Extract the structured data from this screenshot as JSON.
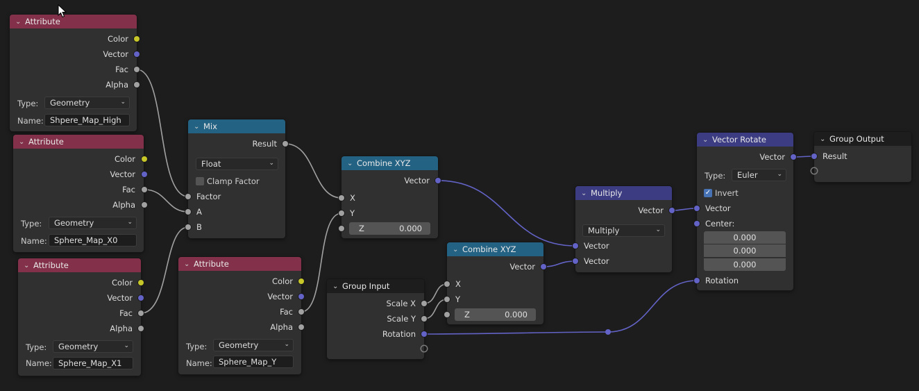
{
  "editor": "Geometry Node Editor",
  "colors": {
    "attribute_header": "#83314a",
    "converter_header": "#246283",
    "vector_header": "#3c3c83",
    "group_header": "#1d1d1d",
    "socket_color": "#c7c729",
    "socket_vector": "#6363c7",
    "socket_float": "#a1a1a1",
    "link_float": "#a1a1a1",
    "link_vector": "#6363c7"
  },
  "nodes": {
    "attr1": {
      "title": "Attribute",
      "outputs": [
        "Color",
        "Vector",
        "Fac",
        "Alpha"
      ],
      "type_label": "Type:",
      "type_value": "Geometry",
      "name_label": "Name:",
      "name_value": "Shpere_Map_High"
    },
    "attr2": {
      "title": "Attribute",
      "outputs": [
        "Color",
        "Vector",
        "Fac",
        "Alpha"
      ],
      "type_label": "Type:",
      "type_value": "Geometry",
      "name_label": "Name:",
      "name_value": "Sphere_Map_X0"
    },
    "attr3": {
      "title": "Attribute",
      "outputs": [
        "Color",
        "Vector",
        "Fac",
        "Alpha"
      ],
      "type_label": "Type:",
      "type_value": "Geometry",
      "name_label": "Name:",
      "name_value": "Sphere_Map_X1"
    },
    "attr4": {
      "title": "Attribute",
      "outputs": [
        "Color",
        "Vector",
        "Fac",
        "Alpha"
      ],
      "type_label": "Type:",
      "type_value": "Geometry",
      "name_label": "Name:",
      "name_value": "Sphere_Map_Y"
    },
    "mix": {
      "title": "Mix",
      "output": "Result",
      "data_type": "Float",
      "clamp_label": "Clamp Factor",
      "clamp_checked": false,
      "inputs": [
        "Factor",
        "A",
        "B"
      ]
    },
    "combine1": {
      "title": "Combine XYZ",
      "output": "Vector",
      "inputs": [
        "X",
        "Y"
      ],
      "z_label": "Z",
      "z_value": "0.000"
    },
    "combine2": {
      "title": "Combine XYZ",
      "output": "Vector",
      "inputs": [
        "X",
        "Y"
      ],
      "z_label": "Z",
      "z_value": "0.000"
    },
    "group_input": {
      "title": "Group Input",
      "outputs": [
        "Scale X",
        "Scale Y",
        "Rotation"
      ]
    },
    "multiply": {
      "title": "Multiply",
      "output": "Vector",
      "operation": "Multiply",
      "inputs": [
        "Vector",
        "Vector"
      ]
    },
    "vector_rotate": {
      "title": "Vector Rotate",
      "output": "Vector",
      "type_label": "Type:",
      "type_value": "Euler",
      "invert_label": "Invert",
      "invert_checked": true,
      "inputs": [
        "Vector",
        "Center:",
        "Rotation"
      ],
      "center_values": [
        "0.000",
        "0.000",
        "0.000"
      ]
    },
    "group_output": {
      "title": "Group Output",
      "inputs": [
        "Result"
      ]
    }
  },
  "icons": {
    "chevron": "⌄",
    "caret": "⌄",
    "check": "✓"
  }
}
